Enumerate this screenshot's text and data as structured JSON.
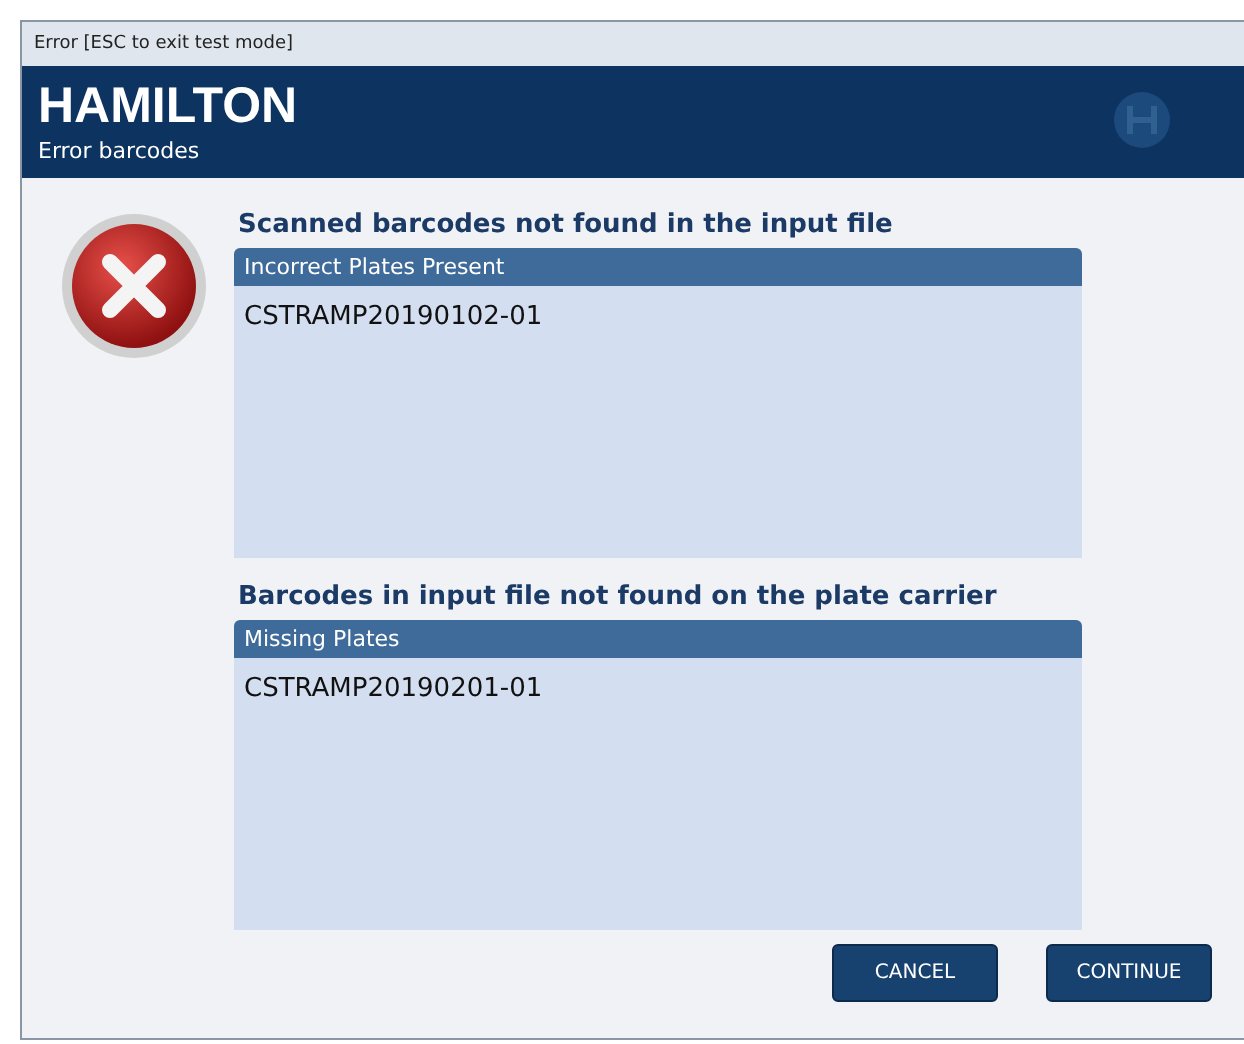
{
  "window": {
    "title": "Error [ESC to exit test mode]"
  },
  "header": {
    "logo": "HAMILTON",
    "subtitle": "Error barcodes"
  },
  "sections": [
    {
      "heading": "Scanned barcodes not found in the input file",
      "list_title": "Incorrect Plates Present",
      "items": [
        "CSTRAMP20190102-01"
      ]
    },
    {
      "heading": "Barcodes in input file not found on the plate carrier",
      "list_title": "Missing Plates",
      "items": [
        "CSTRAMP20190201-01"
      ]
    }
  ],
  "buttons": [
    "CANCEL",
    "CONTINUE"
  ]
}
